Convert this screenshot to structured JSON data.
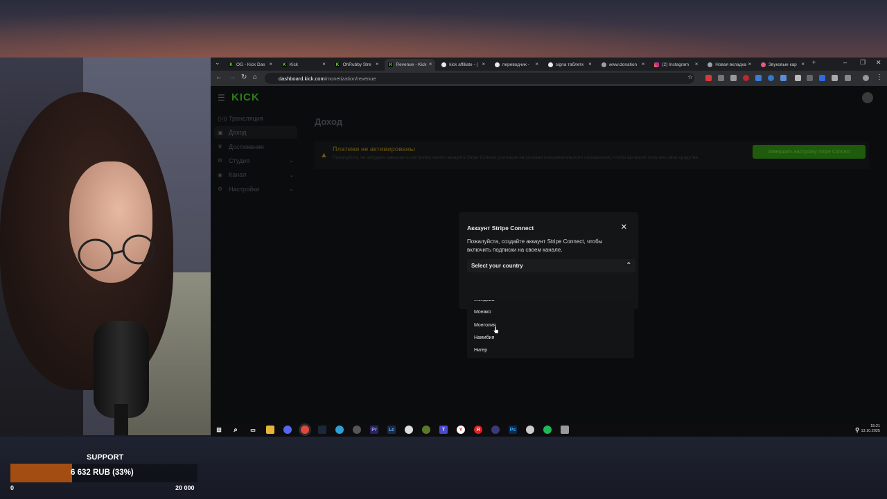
{
  "browser": {
    "tabs": [
      {
        "title": "OG - Kick Das",
        "icon": "kick-icon",
        "active": false
      },
      {
        "title": "Kick",
        "icon": "kick-icon",
        "active": false
      },
      {
        "title": "OhRubby Stre",
        "icon": "kick-icon",
        "active": false
      },
      {
        "title": "Revenue - Kick",
        "icon": "kick-icon",
        "active": true
      },
      {
        "title": "kick affiliate - (",
        "icon": "google-icon",
        "active": false
      },
      {
        "title": "переводчик -",
        "icon": "google-icon",
        "active": false
      },
      {
        "title": "signa таблетк",
        "icon": "google-icon",
        "active": false
      },
      {
        "title": "www.donation",
        "icon": "globe-icon",
        "active": false
      },
      {
        "title": "(2) Instagram",
        "icon": "instagram-icon",
        "active": false
      },
      {
        "title": "Новая вкладка",
        "icon": "chrome-icon",
        "active": false
      },
      {
        "title": "Звуковые кар",
        "icon": "sound-icon",
        "active": false
      }
    ],
    "url_host": "dashboard.kick.com",
    "url_path": "/monetization/revenue"
  },
  "kick": {
    "logo": "KICK",
    "sidebar": [
      {
        "label": "Трансляция",
        "icon": "broadcast-icon",
        "chevron": false
      },
      {
        "label": "Доход",
        "icon": "revenue-icon",
        "chevron": false,
        "current": true
      },
      {
        "label": "Достижения",
        "icon": "trophy-icon",
        "chevron": false
      },
      {
        "label": "Студия",
        "icon": "studio-icon",
        "chevron": true
      },
      {
        "label": "Канал",
        "icon": "channel-icon",
        "chevron": true
      },
      {
        "label": "Настройки",
        "icon": "settings-icon",
        "chevron": true
      }
    ],
    "page_title": "Доход",
    "warning": {
      "title": "Платежи не активированы",
      "description": "Пожалуйста, не забудьте завершить настройку своего аккаунта Stripe Connect (согласие на условия пользовательского соглашения), чтобы вы могли получать свои средства.",
      "button": "Завершить настройку Stripe Connect"
    }
  },
  "modal": {
    "title": "Аккаунт Stripe Connect",
    "body": "Пожалуйста, создайте аккаунт Stripe Connect, чтобы включить подписки на своем канале.",
    "select_placeholder": "Select your country",
    "options": [
      "Молдова",
      "Монако",
      "Монголия",
      "Намибия",
      "Нигер"
    ],
    "hovered_option": "Монголия"
  },
  "taskbar": {
    "time": "15:21",
    "date": "13.10.2025"
  },
  "support": {
    "title": "SUPPORT",
    "amount": "6 632 RUB (33%)",
    "progress_fraction": 0.33,
    "min": "0",
    "max": "20 000"
  },
  "colors": {
    "kick_green": "#53fc18",
    "progress_fill": "#a34d12",
    "warning_text": "#574712"
  }
}
